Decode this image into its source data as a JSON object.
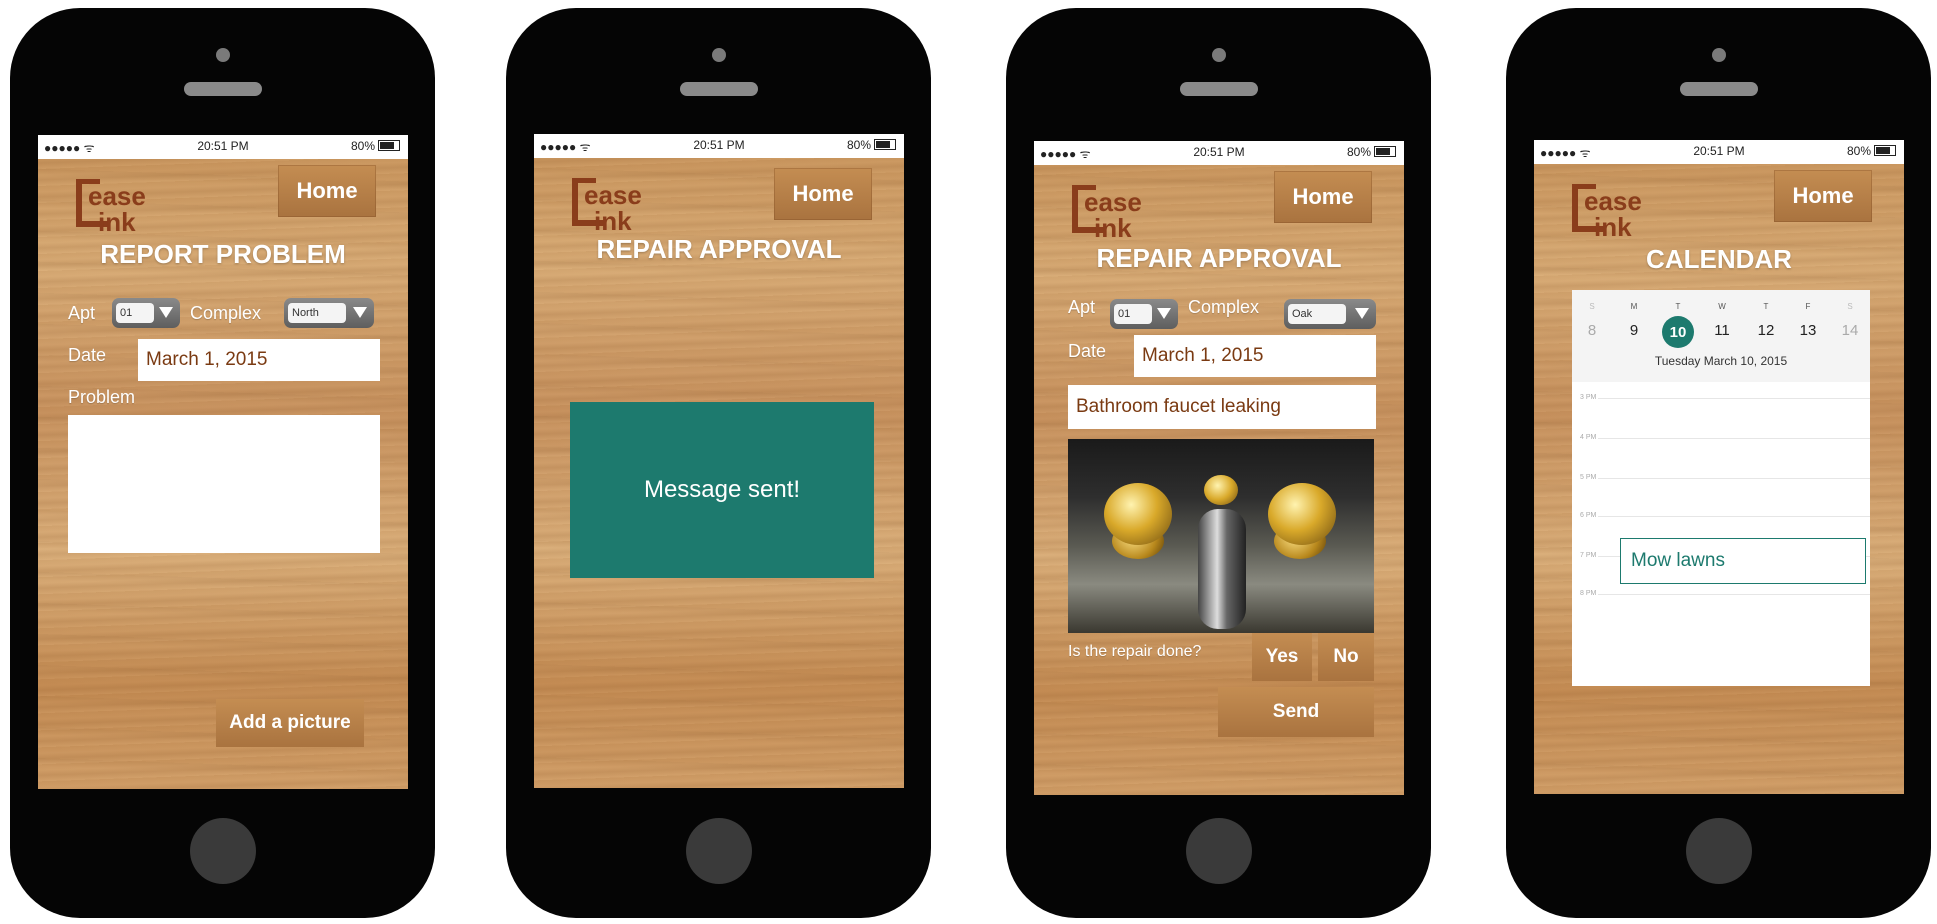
{
  "status_bar": {
    "signal": "●●●●● ᯤ",
    "time": "20:51 PM",
    "battery": "80%"
  },
  "logo": {
    "line1": "ease",
    "line2": "ink"
  },
  "home_label": "Home",
  "screens": {
    "report": {
      "title": "REPORT PROBLEM",
      "apt_label": "Apt",
      "apt_value": "01",
      "complex_label": "Complex",
      "complex_value": "North",
      "date_label": "Date",
      "date_value": "March 1, 2015",
      "problem_label": "Problem",
      "problem_value": "",
      "add_picture": "Add a picture"
    },
    "approval_sent": {
      "title": "REPAIR APPROVAL",
      "message": "Message sent!"
    },
    "approval": {
      "title": "REPAIR APPROVAL",
      "apt_label": "Apt",
      "apt_value": "01",
      "complex_label": "Complex",
      "complex_value": "Oak",
      "date_label": "Date",
      "date_value": "March 1, 2015",
      "problem_value": "Bathroom faucet leaking",
      "question": "Is the repair done?",
      "yes": "Yes",
      "no": "No",
      "send": "Send"
    },
    "calendar": {
      "title": "CALENDAR",
      "weekdays": [
        "S",
        "M",
        "T",
        "W",
        "T",
        "F",
        "S"
      ],
      "days": [
        "8",
        "9",
        "10",
        "11",
        "12",
        "13",
        "14"
      ],
      "selected_date_text": "Tuesday  March 10, 2015",
      "hours": [
        "3 PM",
        "4 PM",
        "5 PM",
        "6 PM",
        "7 PM",
        "8 PM"
      ],
      "event": "Mow lawns"
    }
  },
  "colors": {
    "accent": "#1d7a6e",
    "logo": "#8a3d1b",
    "wood": "#d2a06a"
  }
}
